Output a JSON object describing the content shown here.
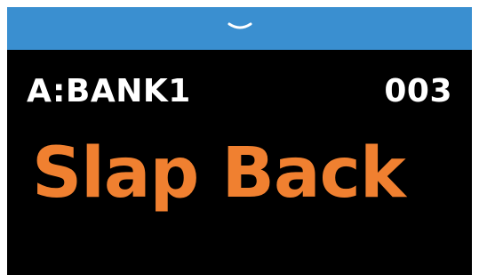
{
  "header": {
    "collapse_icon": "chevron-down-icon",
    "color": "#3a8fd0"
  },
  "display": {
    "bank": "A:BANK1",
    "preset_number": "003",
    "preset_name": "Slap Back",
    "name_color": "#f08030",
    "background": "#000000"
  }
}
